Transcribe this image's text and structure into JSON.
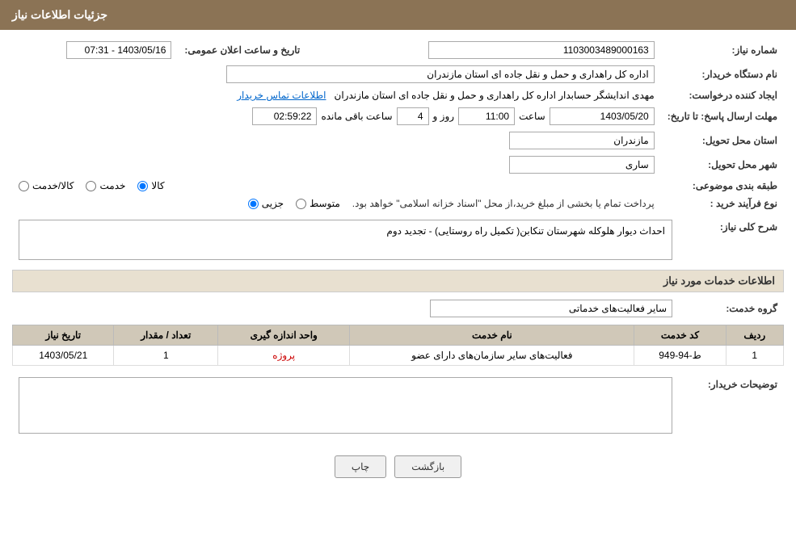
{
  "header": {
    "title": "جزئیات اطلاعات نیاز"
  },
  "fields": {
    "need_number_label": "شماره نیاز:",
    "need_number_value": "1103003489000163",
    "public_date_label": "تاریخ و ساعت اعلان عمومی:",
    "public_date_value": "1403/05/16 - 07:31",
    "buyer_org_label": "نام دستگاه خریدار:",
    "buyer_org_value": "اداره کل راهداری و حمل و نقل جاده ای استان مازندران",
    "creator_label": "ایجاد کننده درخواست:",
    "creator_value": "مهدی اندایشگر حسابدار اداره کل راهداری و حمل و نقل جاده ای استان مازندران",
    "creator_link": "اطلاعات تماس خریدار",
    "reply_deadline_label": "مهلت ارسال پاسخ: تا تاریخ:",
    "reply_date": "1403/05/20",
    "reply_time_label": "ساعت",
    "reply_time": "11:00",
    "reply_days_label": "روز و",
    "reply_days": "4",
    "reply_remaining_label": "ساعت باقی مانده",
    "reply_remaining": "02:59:22",
    "province_label": "استان محل تحویل:",
    "province_value": "مازندران",
    "city_label": "شهر محل تحویل:",
    "city_value": "ساری",
    "category_label": "طبقه بندی موضوعی:",
    "category_options": [
      "کالا",
      "خدمت",
      "کالا/خدمت"
    ],
    "category_selected": "کالا",
    "purchase_type_label": "نوع فرآیند خرید :",
    "purchase_options": [
      "جزیی",
      "متوسط"
    ],
    "purchase_note": "پرداخت تمام یا بخشی از مبلغ خرید،از محل \"اسناد خزانه اسلامی\" خواهد بود.",
    "description_label": "شرح کلی نیاز:",
    "description_value": "احداث دیوار هلوکله شهرستان تنکابن( تکمیل راه روستایی) - تجدید دوم"
  },
  "services_section": {
    "title": "اطلاعات خدمات مورد نیاز",
    "group_label": "گروه خدمت:",
    "group_value": "سایر فعالیت‌های خدماتی",
    "table_headers": [
      "ردیف",
      "کد خدمت",
      "نام خدمت",
      "واحد اندازه گیری",
      "تعداد / مقدار",
      "تاریخ نیاز"
    ],
    "table_rows": [
      {
        "row": "1",
        "code": "ط-94-949",
        "name": "فعالیت‌های سایر سازمان‌های دارای عضو",
        "unit": "پروژه",
        "qty": "1",
        "date": "1403/05/21"
      }
    ]
  },
  "buyer_notes_label": "توضیحات خریدار:",
  "buttons": {
    "print": "چاپ",
    "back": "بازگشت"
  }
}
